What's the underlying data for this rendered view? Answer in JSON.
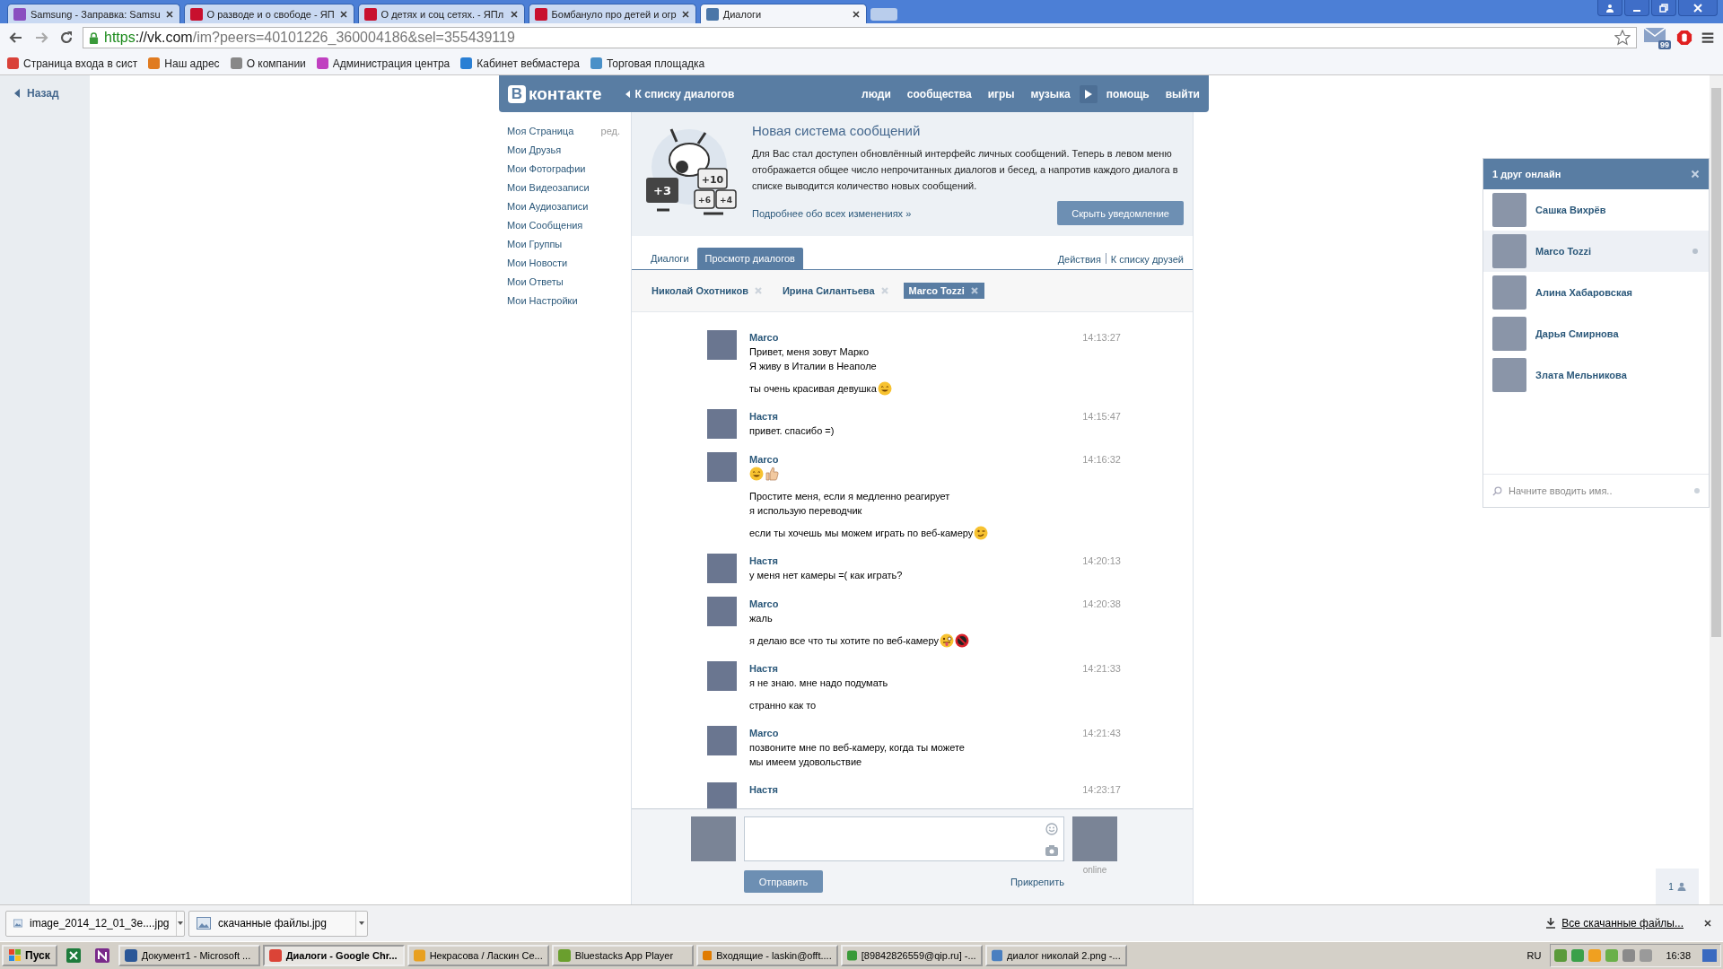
{
  "browser": {
    "tabs": [
      {
        "title": "Samsung - Заправка: Samsu",
        "selected": false
      },
      {
        "title": "О разводе и о свободе - ЯП",
        "selected": false
      },
      {
        "title": "О детях и соц сетях. - ЯПл",
        "selected": false
      },
      {
        "title": "Бомбануло про детей и огр",
        "selected": false
      },
      {
        "title": "Диалоги",
        "selected": true
      }
    ],
    "address": {
      "scheme": "https",
      "host": "://vk.com",
      "path": "/im?peers=40101226_360004186&sel=355439119"
    },
    "mail_badge": "99",
    "bookmarks": [
      "Страница входа в сист",
      "Наш адрес",
      "О компании",
      "Администрация центра",
      "Кабинет вебмастера",
      "Торговая площадка"
    ]
  },
  "back_link": "Назад",
  "header": {
    "logo_mark": "В",
    "logo_text": "контакте",
    "back": "К списку диалогов",
    "nav": [
      {
        "kind": "link",
        "label": "люди"
      },
      {
        "kind": "link",
        "label": "сообщества"
      },
      {
        "kind": "link",
        "label": "игры"
      },
      {
        "kind": "link",
        "label": "музыка"
      },
      {
        "kind": "play"
      },
      {
        "kind": "link",
        "label": "помощь"
      },
      {
        "kind": "link",
        "label": "выйти"
      }
    ]
  },
  "sidebar": {
    "edit": "ред.",
    "items": [
      "Моя Страница",
      "Мои Друзья",
      "Мои Фотографии",
      "Мои Видеозаписи",
      "Мои Аудиозаписи",
      "Мои Сообщения",
      "Мои Группы",
      "Мои Новости",
      "Мои Ответы",
      "Мои Настройки"
    ]
  },
  "notice": {
    "title": "Новая система сообщений",
    "body": "Для Вас стал доступен обновлённый интерфейс личных сообщений. Теперь в левом меню отображается общее число непрочитанных диалогов и бесед, а напротив каждого диалога в списке выводится количество новых сообщений.",
    "link": "Подробнее обо всех изменениях »",
    "button": "Скрыть уведомление",
    "badges": [
      "+3",
      "+10",
      "+6",
      "+4"
    ]
  },
  "tabs": [
    {
      "label": "Диалоги",
      "selected": false
    },
    {
      "label": "Просмотр диалогов",
      "selected": true
    }
  ],
  "actions": [
    "Действия",
    "К списку друзей"
  ],
  "peers": [
    {
      "name": "Николай Охотников",
      "selected": false
    },
    {
      "name": "Ирина Силантьева",
      "selected": false
    },
    {
      "name": "Marco Tozzi",
      "selected": true
    }
  ],
  "messages": [
    {
      "sender": "Marco",
      "time": "14:13:27",
      "texts": [
        {
          "lines": [
            "Привет, меня зовут Марко",
            "Я живу в Италии в Неаполе"
          ]
        },
        {
          "lines": [
            "ты очень красивая девушка"
          ],
          "emoji": [
            {
              "kind": "smile"
            }
          ]
        }
      ]
    },
    {
      "sender": "Настя",
      "time": "14:15:47",
      "texts": [
        {
          "lines": [
            "привет. спасибо =)"
          ]
        }
      ]
    },
    {
      "sender": "Marco",
      "time": "14:16:32",
      "texts": [
        {
          "emoji": [
            {
              "kind": "smile"
            },
            {
              "kind": "thumbs-up"
            }
          ]
        },
        {
          "lines": [
            "Простите меня, если я медленно реагирует",
            "я использую переводчик"
          ]
        },
        {
          "lines": [
            "если ты хочешь мы можем играть по веб-камеру"
          ],
          "emoji": [
            {
              "kind": "wink"
            }
          ]
        }
      ]
    },
    {
      "sender": "Настя",
      "time": "14:20:13",
      "texts": [
        {
          "lines": [
            "у меня нет камеры =( как играть?"
          ]
        }
      ]
    },
    {
      "sender": "Marco",
      "time": "14:20:38",
      "texts": [
        {
          "lines": [
            "жаль"
          ]
        },
        {
          "lines": [
            "я делаю все что ты хотите по веб-камеру"
          ],
          "emoji": [
            {
              "kind": "tongue"
            },
            {
              "kind": "prohibited"
            }
          ]
        }
      ]
    },
    {
      "sender": "Настя",
      "time": "14:21:33",
      "texts": [
        {
          "lines": [
            "я не знаю. мне надо подумать"
          ]
        },
        {
          "lines": [
            "странно как то"
          ]
        }
      ]
    },
    {
      "sender": "Marco",
      "time": "14:21:43",
      "texts": [
        {
          "lines": [
            "позвоните мне по веб-камеру, когда ты можете",
            "мы имеем удовольствие"
          ]
        }
      ]
    },
    {
      "sender": "Настя",
      "time": "14:23:17"
    }
  ],
  "composer": {
    "send": "Отправить",
    "attach": "Прикрепить",
    "status": "online"
  },
  "friends_panel": {
    "title": "1 друг онлайн",
    "friends": [
      {
        "name": "Сашка Вихрёв",
        "selected": false
      },
      {
        "name": "Marco Tozzi",
        "selected": true
      },
      {
        "name": "Алина Хабаровская",
        "selected": false
      },
      {
        "name": "Дарья Смирнова",
        "selected": false
      },
      {
        "name": "Злата Мельникова",
        "selected": false
      }
    ],
    "search_placeholder": "Начните вводить имя.."
  },
  "counter": "1",
  "downloads": {
    "files": [
      "image_2014_12_01_3e....jpg",
      "скачанные файлы.jpg"
    ],
    "all_link": "Все скачанные файлы..."
  },
  "taskbar": {
    "start": "Пуск",
    "tasks": [
      {
        "title": "Документ1 - Microsoft ...",
        "selected": false
      },
      {
        "title": "Диалоги - Google Chr...",
        "selected": true
      },
      {
        "title": "Некрасова / Ласкин Се...",
        "selected": false
      },
      {
        "title": "Bluestacks App Player",
        "selected": false
      },
      {
        "title": "Входящие - laskin@offt....",
        "selected": false
      },
      {
        "title": "[89842826559@qip.ru] -...",
        "selected": false
      },
      {
        "title": "диалог николай 2.png -...",
        "selected": false
      }
    ],
    "language": "RU",
    "clock": "16:38"
  }
}
